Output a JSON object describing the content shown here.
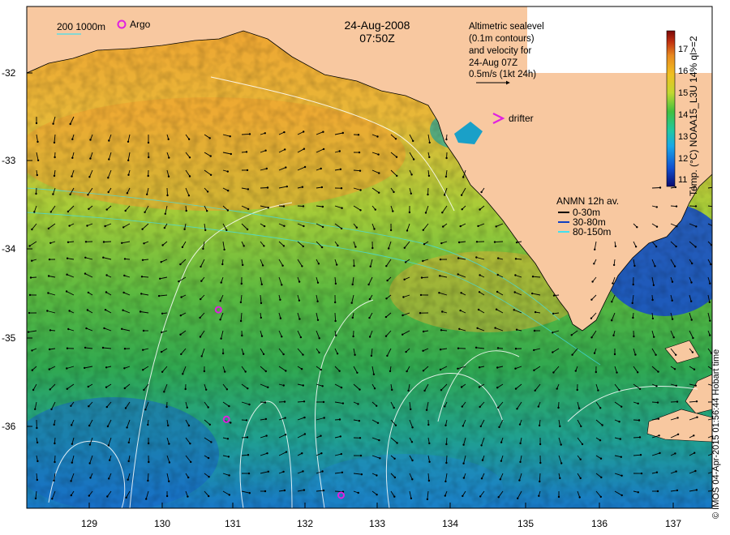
{
  "title": {
    "date": "24-Aug-2008",
    "time": "07:50Z"
  },
  "scale": {
    "contours": "200  1000m"
  },
  "legend": {
    "argo": "Argo",
    "drifter": "drifter",
    "altimetry": [
      "Altimetric sealevel",
      "(0.1m contours)",
      "and velocity for",
      "24-Aug 07Z",
      "0.5m/s (1kt 24h)"
    ],
    "anmn_title": "ANMN 12h av.",
    "anmn_items": [
      {
        "label": "0-30m",
        "color": "#000000"
      },
      {
        "label": "30-80m",
        "color": "#1040c0"
      },
      {
        "label": "80-150m",
        "color": "#40e0f0"
      }
    ]
  },
  "colorbar": {
    "title": "Temp. (°C) NOAA15_L3U 14% ql>=2",
    "ticks": [
      "11",
      "12",
      "13",
      "14",
      "15",
      "16",
      "17"
    ],
    "range": [
      10.5,
      17.5
    ],
    "colors": [
      "#0a0a70",
      "#1050d0",
      "#18a8e8",
      "#20c8a0",
      "#40c040",
      "#c0d830",
      "#f0c020",
      "#e88a20",
      "#c03010",
      "#7a0808"
    ]
  },
  "axes": {
    "x_ticks": [
      "129",
      "130",
      "131",
      "132",
      "133",
      "134",
      "135",
      "136",
      "137"
    ],
    "y_ticks": [
      "-32",
      "-33",
      "-34",
      "-35",
      "-36"
    ]
  },
  "colors": {
    "land": "#f8c8a0",
    "argo_marker": "#e020e0",
    "drifter_marker": "#e020e0"
  },
  "argo_floats": [
    {
      "lon": 130.77,
      "lat": -34.68
    },
    {
      "lon": 130.88,
      "lat": -35.92
    },
    {
      "lon": 132.45,
      "lat": -36.78
    }
  ],
  "credit": "© IMOS 04-Apr-2015 01:56:44 Hobart time"
}
